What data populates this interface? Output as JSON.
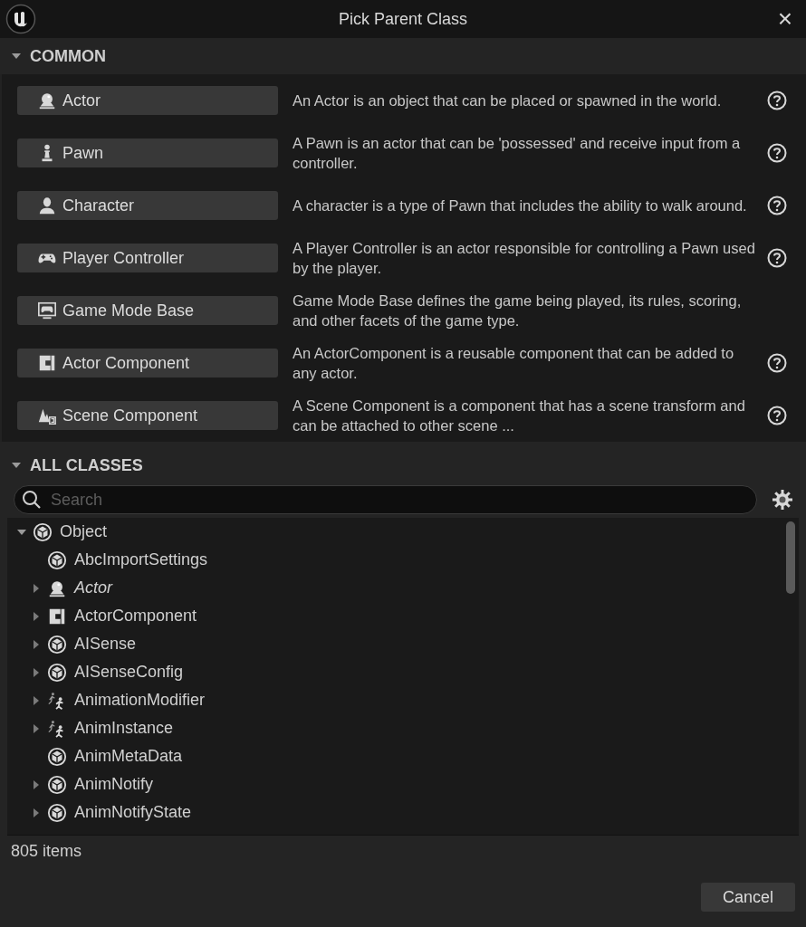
{
  "window": {
    "title": "Pick Parent Class",
    "close": "×"
  },
  "common": {
    "title": "COMMON",
    "expanded": true,
    "items": [
      {
        "label": "Actor",
        "kind": "actor",
        "description": "An Actor is an object that can be placed or spawned in the world.",
        "help": true
      },
      {
        "label": "Pawn",
        "kind": "pawn",
        "description": "A Pawn is an actor that can be 'possessed' and receive input from a controller.",
        "help": true
      },
      {
        "label": "Character",
        "kind": "character",
        "description": "A character is a type of Pawn that includes the ability to walk around.",
        "help": true
      },
      {
        "label": "Player Controller",
        "kind": "gamepad",
        "description": "A Player Controller is an actor responsible for controlling a Pawn used by the player.",
        "help": true
      },
      {
        "label": "Game Mode Base",
        "kind": "gamemode",
        "description": "Game Mode Base defines the game being played, its rules, scoring, and other facets of the game type.",
        "help": false
      },
      {
        "label": "Actor Component",
        "kind": "component",
        "description": "An ActorComponent is a reusable component that can be added to any actor.",
        "help": true
      },
      {
        "label": "Scene Component",
        "kind": "scene",
        "description": "A Scene Component is a component that has a scene transform and can be attached to other scene ...",
        "help": true
      }
    ]
  },
  "all_classes": {
    "title": "ALL CLASSES",
    "expanded": true,
    "search": {
      "placeholder": "Search"
    },
    "tree": [
      {
        "label": "Object",
        "kind": "object",
        "expandable": true,
        "expanded": true,
        "italic": false,
        "children": [
          {
            "label": "AbcImportSettings",
            "kind": "object",
            "expandable": false,
            "expanded": false,
            "italic": false
          },
          {
            "label": "Actor",
            "kind": "actor",
            "expandable": true,
            "expanded": false,
            "italic": true
          },
          {
            "label": "ActorComponent",
            "kind": "component",
            "expandable": true,
            "expanded": false,
            "italic": false
          },
          {
            "label": "AISense",
            "kind": "object",
            "expandable": true,
            "expanded": false,
            "italic": false
          },
          {
            "label": "AISenseConfig",
            "kind": "object",
            "expandable": true,
            "expanded": false,
            "italic": false
          },
          {
            "label": "AnimationModifier",
            "kind": "anim",
            "expandable": true,
            "expanded": false,
            "italic": false
          },
          {
            "label": "AnimInstance",
            "kind": "anim",
            "expandable": true,
            "expanded": false,
            "italic": false
          },
          {
            "label": "AnimMetaData",
            "kind": "object",
            "expandable": false,
            "expanded": false,
            "italic": false
          },
          {
            "label": "AnimNotify",
            "kind": "object",
            "expandable": true,
            "expanded": false,
            "italic": false
          },
          {
            "label": "AnimNotifyState",
            "kind": "object",
            "expandable": true,
            "expanded": false,
            "italic": false
          }
        ]
      }
    ],
    "status": "805 items"
  },
  "buttons": [
    {
      "label": "Cancel"
    }
  ]
}
